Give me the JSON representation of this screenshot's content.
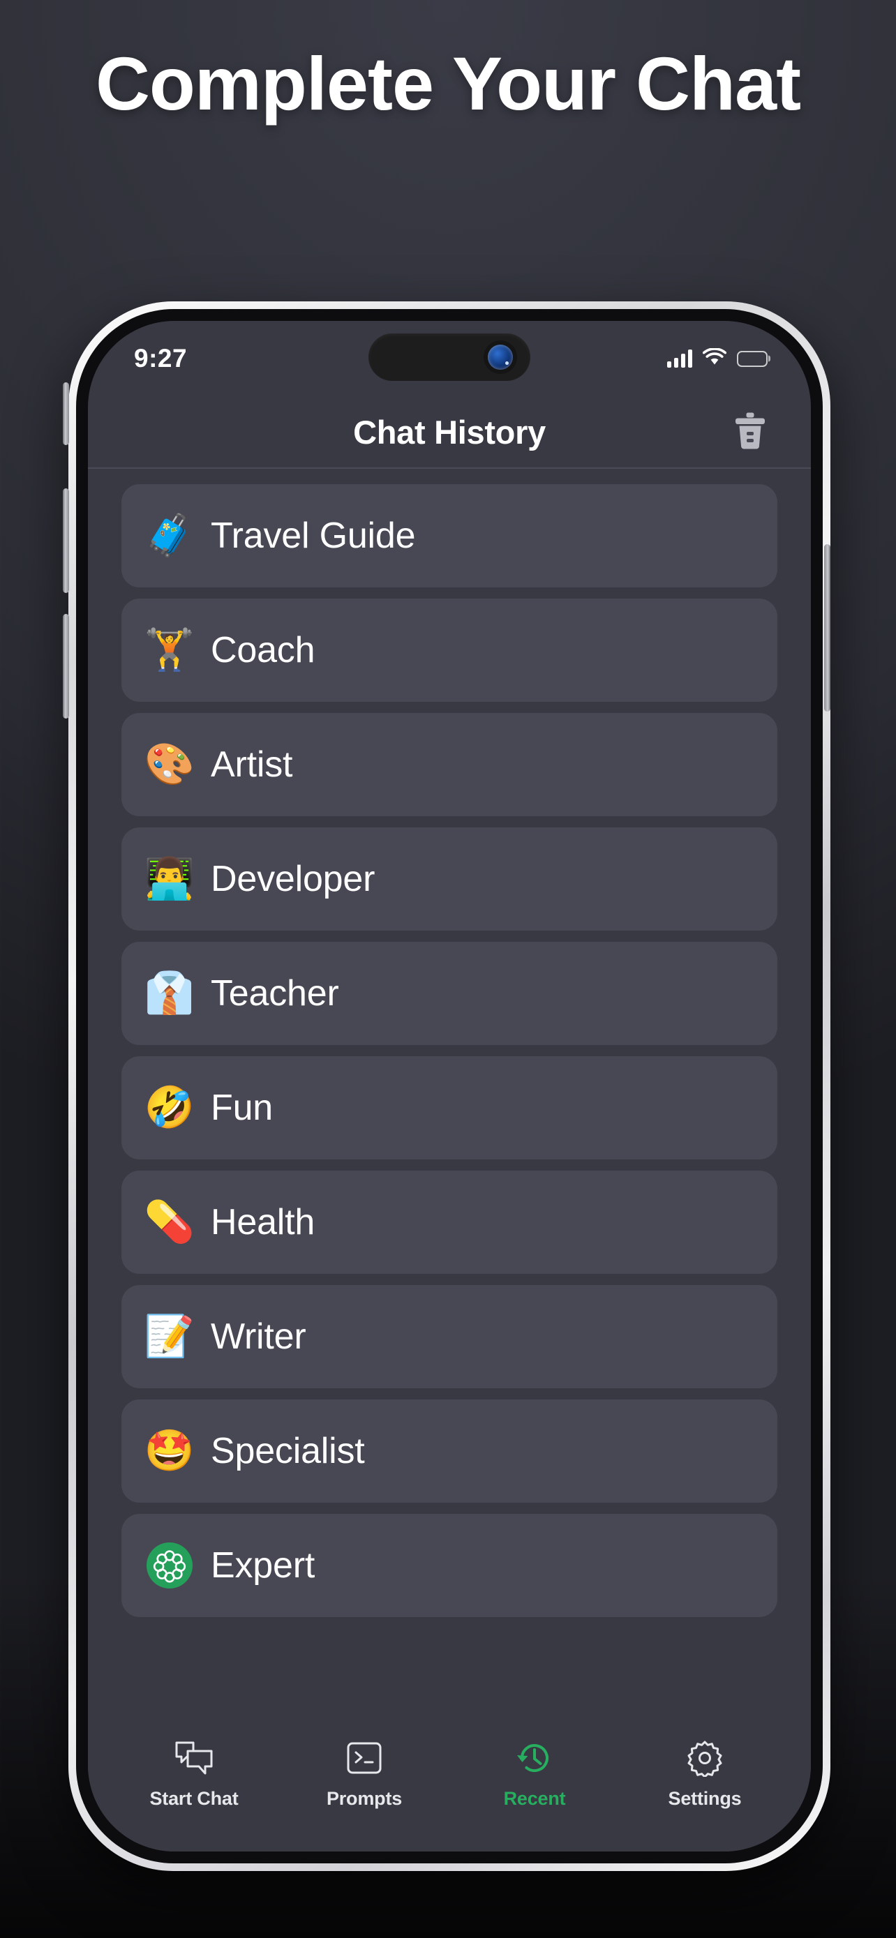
{
  "promo": {
    "headline": "Complete Your Chat"
  },
  "colors": {
    "accent": "#27ae5f",
    "screen_bg": "#383943",
    "row_bg": "#474853",
    "text": "#ffffff",
    "expert_badge": "#25a05a"
  },
  "statusbar": {
    "time": "9:27",
    "signal_icon": "cellular-signal-icon",
    "wifi_icon": "wifi-icon",
    "battery_icon": "battery-full-icon"
  },
  "navbar": {
    "title": "Chat History",
    "delete_icon": "trash-icon"
  },
  "list": {
    "items": [
      {
        "emoji": "🧳",
        "emoji_name": "luggage-icon",
        "label": "Travel Guide"
      },
      {
        "emoji": "🏋️",
        "emoji_name": "weightlifter-icon",
        "label": "Coach"
      },
      {
        "emoji": "🎨",
        "emoji_name": "artist-palette-icon",
        "label": "Artist"
      },
      {
        "emoji": "👨‍💻",
        "emoji_name": "technologist-icon",
        "label": "Developer"
      },
      {
        "emoji": "👔",
        "emoji_name": "man-in-tie-icon",
        "label": "Teacher"
      },
      {
        "emoji": "🤣",
        "emoji_name": "rofl-face-icon",
        "label": "Fun"
      },
      {
        "emoji": "💊",
        "emoji_name": "pill-icon",
        "label": "Health"
      },
      {
        "emoji": "📝",
        "emoji_name": "memo-icon",
        "label": "Writer"
      },
      {
        "emoji": "🤩",
        "emoji_name": "star-struck-icon",
        "label": "Specialist"
      },
      {
        "emoji": "",
        "emoji_name": "expert-flower-badge-icon",
        "label": "Expert"
      }
    ]
  },
  "tabbar": {
    "tabs": [
      {
        "label": "Start Chat",
        "icon": "chat-bubbles-icon",
        "active": false
      },
      {
        "label": "Prompts",
        "icon": "terminal-icon",
        "active": false
      },
      {
        "label": "Recent",
        "icon": "clock-history-icon",
        "active": true
      },
      {
        "label": "Settings",
        "icon": "gear-icon",
        "active": false
      }
    ]
  }
}
